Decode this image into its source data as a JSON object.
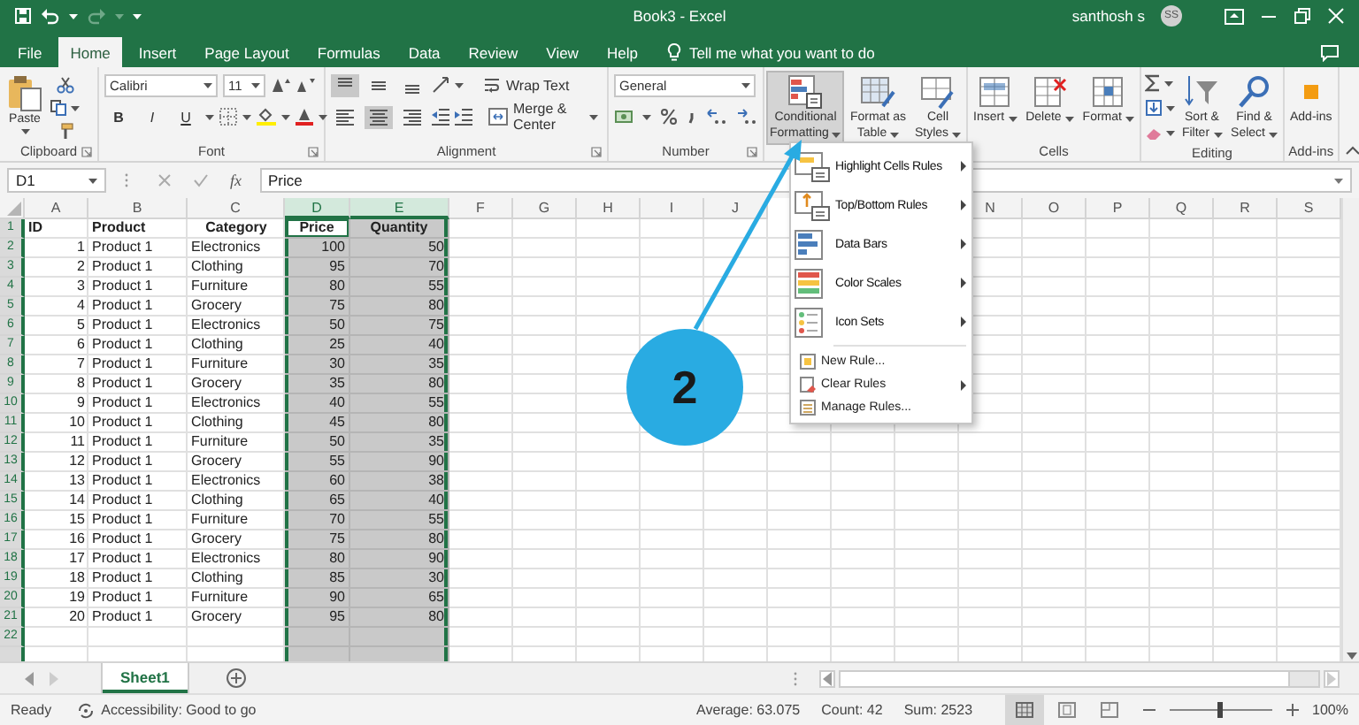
{
  "title_bar": {
    "title": "Book3 - Excel",
    "user": "santhosh s",
    "avatar": "SS"
  },
  "tabs": [
    {
      "label": "File",
      "selected": false
    },
    {
      "label": "Home",
      "selected": true
    },
    {
      "label": "Insert",
      "selected": false
    },
    {
      "label": "Page Layout",
      "selected": false
    },
    {
      "label": "Formulas",
      "selected": false
    },
    {
      "label": "Data",
      "selected": false
    },
    {
      "label": "Review",
      "selected": false
    },
    {
      "label": "View",
      "selected": false
    },
    {
      "label": "Help",
      "selected": false
    }
  ],
  "tell_me": "Tell me what you want to do",
  "ribbon": {
    "groups": [
      {
        "kind": "clipboard",
        "label": "Clipboard",
        "paste": "Paste"
      },
      {
        "kind": "font",
        "label": "Font",
        "font_name": "Calibri",
        "font_size": "11",
        "styles": [
          "B",
          "I",
          "U"
        ]
      },
      {
        "kind": "alignment",
        "label": "Alignment",
        "wrap": "Wrap Text",
        "merge": "Merge & Center",
        "vertical_align": [
          {
            "kind": "top",
            "selected": true
          },
          {
            "kind": "middle",
            "selected": false
          },
          {
            "kind": "bottom",
            "selected": false
          }
        ],
        "horizontal_align": [
          {
            "kind": "left",
            "selected": false
          },
          {
            "kind": "center",
            "selected": true
          },
          {
            "kind": "right",
            "selected": false
          }
        ]
      },
      {
        "kind": "number",
        "label": "Number",
        "format": "General"
      },
      {
        "kind": "styles",
        "buttons": [
          {
            "lines": [
              "Conditional",
              "Formatting"
            ],
            "dropdown": true,
            "pressed": true
          },
          {
            "lines": [
              "Format as",
              "Table"
            ],
            "dropdown": true,
            "pressed": false
          },
          {
            "lines": [
              "Cell",
              "Styles"
            ],
            "dropdown": true,
            "pressed": false
          }
        ]
      },
      {
        "kind": "cells",
        "label": "Cells",
        "buttons": [
          {
            "lines": [
              "Insert"
            ],
            "dropdown": true
          },
          {
            "lines": [
              "Delete"
            ],
            "dropdown": true
          },
          {
            "lines": [
              "Format"
            ],
            "dropdown": true
          }
        ]
      },
      {
        "kind": "editing",
        "label": "Editing",
        "buttons": [
          {
            "lines": [
              "Sort &",
              "Filter"
            ],
            "dropdown": true
          },
          {
            "lines": [
              "Find &",
              "Select"
            ],
            "dropdown": true
          }
        ]
      },
      {
        "kind": "addins",
        "label": "Add-ins",
        "buttons": [
          {
            "lines": [
              "Add-ins"
            ],
            "dropdown": false
          }
        ]
      }
    ]
  },
  "formula_bar": {
    "name_box": "D1",
    "function_label": "fx",
    "formula": "Price"
  },
  "grid": {
    "columns": [
      {
        "label": "A"
      },
      {
        "label": "B"
      },
      {
        "label": "C"
      },
      {
        "label": "D",
        "selected": true,
        "active": true
      },
      {
        "label": "E",
        "selected": true
      },
      {
        "label": "F"
      },
      {
        "label": "G"
      },
      {
        "label": "H"
      },
      {
        "label": "I"
      },
      {
        "label": "J"
      },
      {},
      {},
      {},
      {
        "label": "N"
      },
      {
        "label": "O"
      },
      {
        "label": "P"
      },
      {
        "label": "Q"
      },
      {
        "label": "R"
      },
      {
        "label": "S"
      }
    ],
    "rows": [
      {
        "header": "1",
        "kind": "header",
        "active": true,
        "cells": [
          "ID",
          "Product",
          "Category",
          "Price",
          "Quantity"
        ]
      },
      {
        "header": "2",
        "kind": "data",
        "cells": [
          "1",
          "Product 1",
          "Electronics",
          "100",
          "50"
        ]
      },
      {
        "header": "3",
        "kind": "data",
        "cells": [
          "2",
          "Product 1",
          "Clothing",
          "95",
          "70"
        ]
      },
      {
        "header": "4",
        "kind": "data",
        "cells": [
          "3",
          "Product 1",
          "Furniture",
          "80",
          "55"
        ]
      },
      {
        "header": "5",
        "kind": "data",
        "cells": [
          "4",
          "Product 1",
          "Grocery",
          "75",
          "80"
        ]
      },
      {
        "header": "6",
        "kind": "data",
        "cells": [
          "5",
          "Product 1",
          "Electronics",
          "50",
          "75"
        ]
      },
      {
        "header": "7",
        "kind": "data",
        "cells": [
          "6",
          "Product 1",
          "Clothing",
          "25",
          "40"
        ]
      },
      {
        "header": "8",
        "kind": "data",
        "cells": [
          "7",
          "Product 1",
          "Furniture",
          "30",
          "35"
        ]
      },
      {
        "header": "9",
        "kind": "data",
        "cells": [
          "8",
          "Product 1",
          "Grocery",
          "35",
          "80"
        ]
      },
      {
        "header": "10",
        "kind": "data",
        "cells": [
          "9",
          "Product 1",
          "Electronics",
          "40",
          "55"
        ]
      },
      {
        "header": "11",
        "kind": "data",
        "cells": [
          "10",
          "Product 1",
          "Clothing",
          "45",
          "80"
        ]
      },
      {
        "header": "12",
        "kind": "data",
        "cells": [
          "11",
          "Product 1",
          "Furniture",
          "50",
          "35"
        ]
      },
      {
        "header": "13",
        "kind": "data",
        "cells": [
          "12",
          "Product 1",
          "Grocery",
          "55",
          "90"
        ]
      },
      {
        "header": "14",
        "kind": "data",
        "cells": [
          "13",
          "Product 1",
          "Electronics",
          "60",
          "38"
        ]
      },
      {
        "header": "15",
        "kind": "data",
        "cells": [
          "14",
          "Product 1",
          "Clothing",
          "65",
          "40"
        ]
      },
      {
        "header": "16",
        "kind": "data",
        "cells": [
          "15",
          "Product 1",
          "Furniture",
          "70",
          "55"
        ]
      },
      {
        "header": "17",
        "kind": "data",
        "cells": [
          "16",
          "Product 1",
          "Grocery",
          "75",
          "80"
        ]
      },
      {
        "header": "18",
        "kind": "data",
        "cells": [
          "17",
          "Product 1",
          "Electronics",
          "80",
          "90"
        ]
      },
      {
        "header": "19",
        "kind": "data",
        "cells": [
          "18",
          "Product 1",
          "Clothing",
          "85",
          "30"
        ]
      },
      {
        "header": "20",
        "kind": "data",
        "cells": [
          "19",
          "Product 1",
          "Furniture",
          "90",
          "65"
        ]
      },
      {
        "header": "21",
        "kind": "data",
        "cells": [
          "20",
          "Product 1",
          "Grocery",
          "95",
          "80"
        ]
      },
      {
        "header": "22",
        "kind": "data"
      }
    ]
  },
  "menu": {
    "items": [
      {
        "kind": "large",
        "label": "Highlight Cells Rules",
        "submenu": true
      },
      {
        "kind": "large",
        "label": "Top/Bottom Rules",
        "submenu": true
      },
      {
        "kind": "large",
        "label": "Data Bars",
        "submenu": true
      },
      {
        "kind": "large",
        "label": "Color Scales",
        "submenu": true
      },
      {
        "kind": "large",
        "label": "Icon Sets",
        "submenu": true
      },
      {
        "kind": "small",
        "label": "New Rule...",
        "submenu": false
      },
      {
        "kind": "small",
        "label": "Clear Rules",
        "submenu": true
      },
      {
        "kind": "small",
        "label": "Manage Rules...",
        "submenu": false
      }
    ]
  },
  "callout": {
    "label": "2"
  },
  "sheets": [
    {
      "label": "Sheet1",
      "selected": true
    }
  ],
  "status_bar": {
    "mode": "Ready",
    "accessibility": "Accessibility: Good to go",
    "stats": [
      "Average: 63.075",
      "Count: 42",
      "Sum: 2523"
    ],
    "views": [
      {
        "kind": "normal",
        "selected": true
      },
      {
        "kind": "page_layout",
        "selected": false
      },
      {
        "kind": "page_break",
        "selected": false
      }
    ],
    "zoom": {
      "level": 0.5,
      "reading": "100%"
    }
  }
}
